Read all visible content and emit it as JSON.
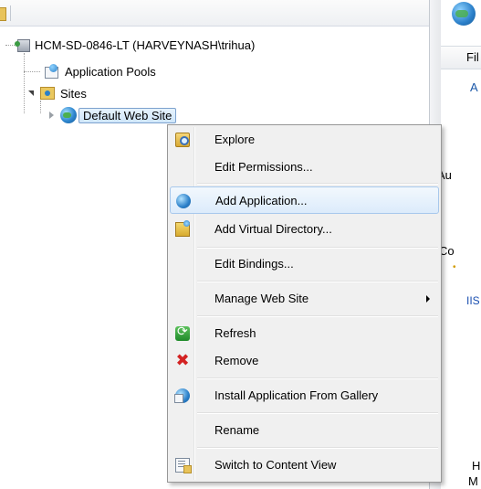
{
  "tree": {
    "server_label": "HCM-SD-0846-LT (HARVEYNASH\\trihua)",
    "app_pools_label": "Application Pools",
    "sites_label": "Sites",
    "default_site_label": "Default Web Site"
  },
  "right_pane": {
    "filter_text": "Fil",
    "link_a": "A",
    "auth_text": "Au",
    "co_text": "Co",
    "dot_text": "•",
    "iis_text": "IIS",
    "h_text": "H",
    "m_text": "M"
  },
  "context_menu": {
    "items": [
      {
        "label": "Explore",
        "icon": "explore-icon"
      },
      {
        "label": "Edit Permissions...",
        "icon": ""
      },
      {
        "label": "Add Application...",
        "icon": "add-application-icon",
        "highlighted": true
      },
      {
        "label": "Add Virtual Directory...",
        "icon": "add-virtual-directory-icon"
      },
      {
        "label": "Edit Bindings...",
        "icon": ""
      },
      {
        "label": "Manage Web Site",
        "icon": "",
        "submenu": true
      },
      {
        "label": "Refresh",
        "icon": "refresh-icon"
      },
      {
        "label": "Remove",
        "icon": "remove-icon",
        "glyph": "✖"
      },
      {
        "label": "Install Application From Gallery",
        "icon": "gallery-icon"
      },
      {
        "label": "Rename",
        "icon": ""
      },
      {
        "label": "Switch to Content View",
        "icon": "content-view-icon"
      }
    ]
  },
  "colors": {
    "menu_bg": "#f0f0f0",
    "highlight_border": "#a8c8ec",
    "selection_border": "#7da2ce",
    "remove_red": "#d32222"
  }
}
